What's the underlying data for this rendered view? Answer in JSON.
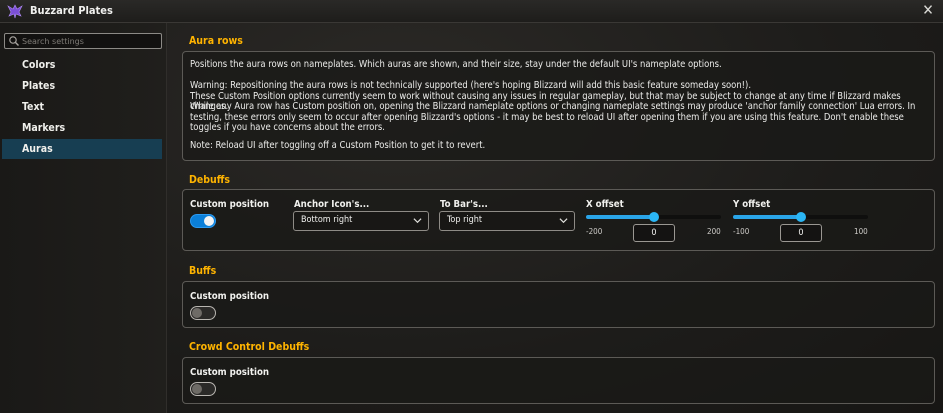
{
  "app": {
    "title": "Buzzard Plates",
    "logo_icon": "buzzard-logo-icon",
    "close_icon": "close-icon"
  },
  "sidebar": {
    "search_placeholder": "Search settings",
    "items": [
      {
        "label": "Colors",
        "active": false
      },
      {
        "label": "Plates",
        "active": false
      },
      {
        "label": "Text",
        "active": false
      },
      {
        "label": "Markers",
        "active": false
      },
      {
        "label": "Auras",
        "active": true
      }
    ]
  },
  "aura_rows": {
    "title": "Aura rows",
    "intro": "Positions the aura rows on nameplates. Which auras are shown, and their size, stay under the default UI's nameplate options.",
    "warning_1": "Warning: Repositioning the aura rows is not technically supported (here's hoping Blizzard will add this basic feature someday soon!).",
    "warning_2": "These Custom Position options currently seem to work without causing any issues in regular gameplay, but that may be subject to change at any time if Blizzard makes changes.",
    "warning_3": "While any Aura row has Custom position on, opening the Blizzard nameplate options or changing nameplate settings may produce 'anchor family connection' Lua errors. In testing, these errors only seem to occur after opening Blizzard's options - it may be best to reload UI after opening them if you are using this feature. Don't enable these toggles if you have concerns about the errors.",
    "note": "Note: Reload UI after toggling off a Custom Position to get it to revert."
  },
  "debuffs": {
    "title": "Debuffs",
    "custom_position_label": "Custom position",
    "custom_position_on": true,
    "anchor_label": "Anchor Icon's...",
    "anchor_value": "Bottom right",
    "to_bar_label": "To Bar's...",
    "to_bar_value": "Top right",
    "x_offset": {
      "label": "X offset",
      "min": -200,
      "max": 200,
      "value": 0,
      "min_label": "-200",
      "max_label": "200",
      "value_text": "0"
    },
    "y_offset": {
      "label": "Y offset",
      "min": -100,
      "max": 100,
      "value": 0,
      "min_label": "-100",
      "max_label": "100",
      "value_text": "0"
    }
  },
  "buffs": {
    "title": "Buffs",
    "custom_position_label": "Custom position",
    "custom_position_on": false
  },
  "cc_debuffs": {
    "title": "Crowd Control Debuffs",
    "custom_position_label": "Custom position",
    "custom_position_on": false
  },
  "colors": {
    "accent": "#ffb400",
    "active_nav": "#173e52",
    "toggle_on": "#0b7fd8",
    "slider": "#2bb6f5"
  }
}
